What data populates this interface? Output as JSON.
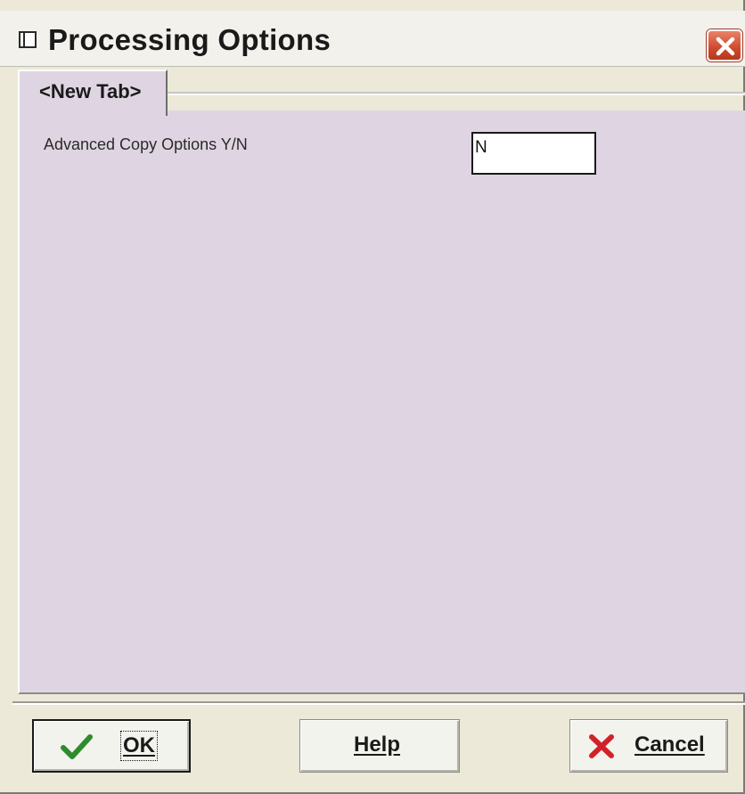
{
  "window": {
    "title": "Processing Options"
  },
  "tabs": [
    {
      "label": "<New Tab>",
      "selected": true
    }
  ],
  "form": {
    "fields": [
      {
        "label": "Advanced Copy Options Y/N",
        "value": "N"
      }
    ]
  },
  "buttons": {
    "ok_label": "OK",
    "help_label": "Help",
    "cancel_label": "Cancel"
  },
  "icons": {
    "app": "window-icon",
    "close": "close-icon",
    "ok": "checkmark-icon",
    "cancel": "red-x-icon"
  },
  "colors": {
    "panel_bg": "#dfd5e2",
    "close_red": "#cf4a2c",
    "check_green": "#2e8b2e",
    "cancel_red": "#d1222a"
  }
}
